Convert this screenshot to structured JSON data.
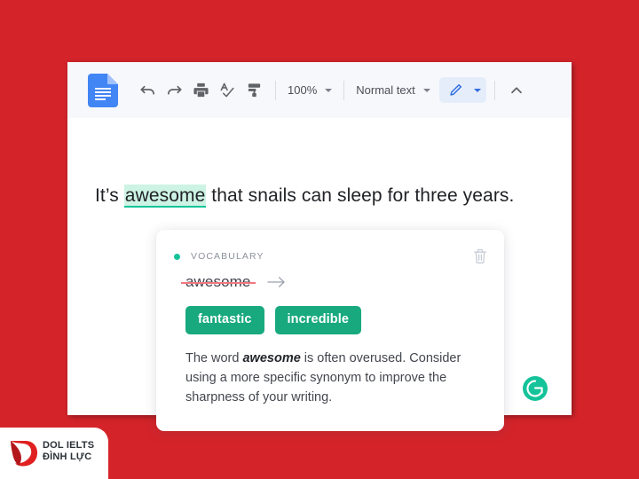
{
  "background_color": "#d4242a",
  "toolbar": {
    "app_icon": "google-docs-icon",
    "undo_label": "Undo",
    "redo_label": "Redo",
    "print_label": "Print",
    "spelling_label": "Spelling and grammar check",
    "paint_format_label": "Paint format",
    "zoom_value": "100%",
    "style_value": "Normal text",
    "edit_mode_label": "Editing",
    "collapse_label": "Hide the menus"
  },
  "document": {
    "sentence_before": "It’s ",
    "sentence_highlight": "awesome",
    "sentence_after": " that snails can sleep for three years.",
    "highlight_color": "#cdf3e4",
    "highlight_underline_color": "#15c39a"
  },
  "card": {
    "category": "VOCABULARY",
    "dot_color": "#15c39a",
    "delete_label": "Delete suggestion",
    "original_word": "awesome",
    "strike_color": "#f2777f",
    "arrow_label": "replace-with",
    "suggestions": [
      {
        "label": "fantastic"
      },
      {
        "label": "incredible"
      }
    ],
    "chip_color": "#18a97f",
    "explanation_part1": "The word ",
    "explanation_bold": "awesome",
    "explanation_part2": " is often overused. Consider using a more specific synonym to improve the sharpness of your writing."
  },
  "grammarly": {
    "label": "Grammarly",
    "color": "#15c39a"
  },
  "watermark": {
    "line1": "DOL IELTS",
    "line2": "ĐÌNH LỰC",
    "mark_color": "#e02020"
  }
}
